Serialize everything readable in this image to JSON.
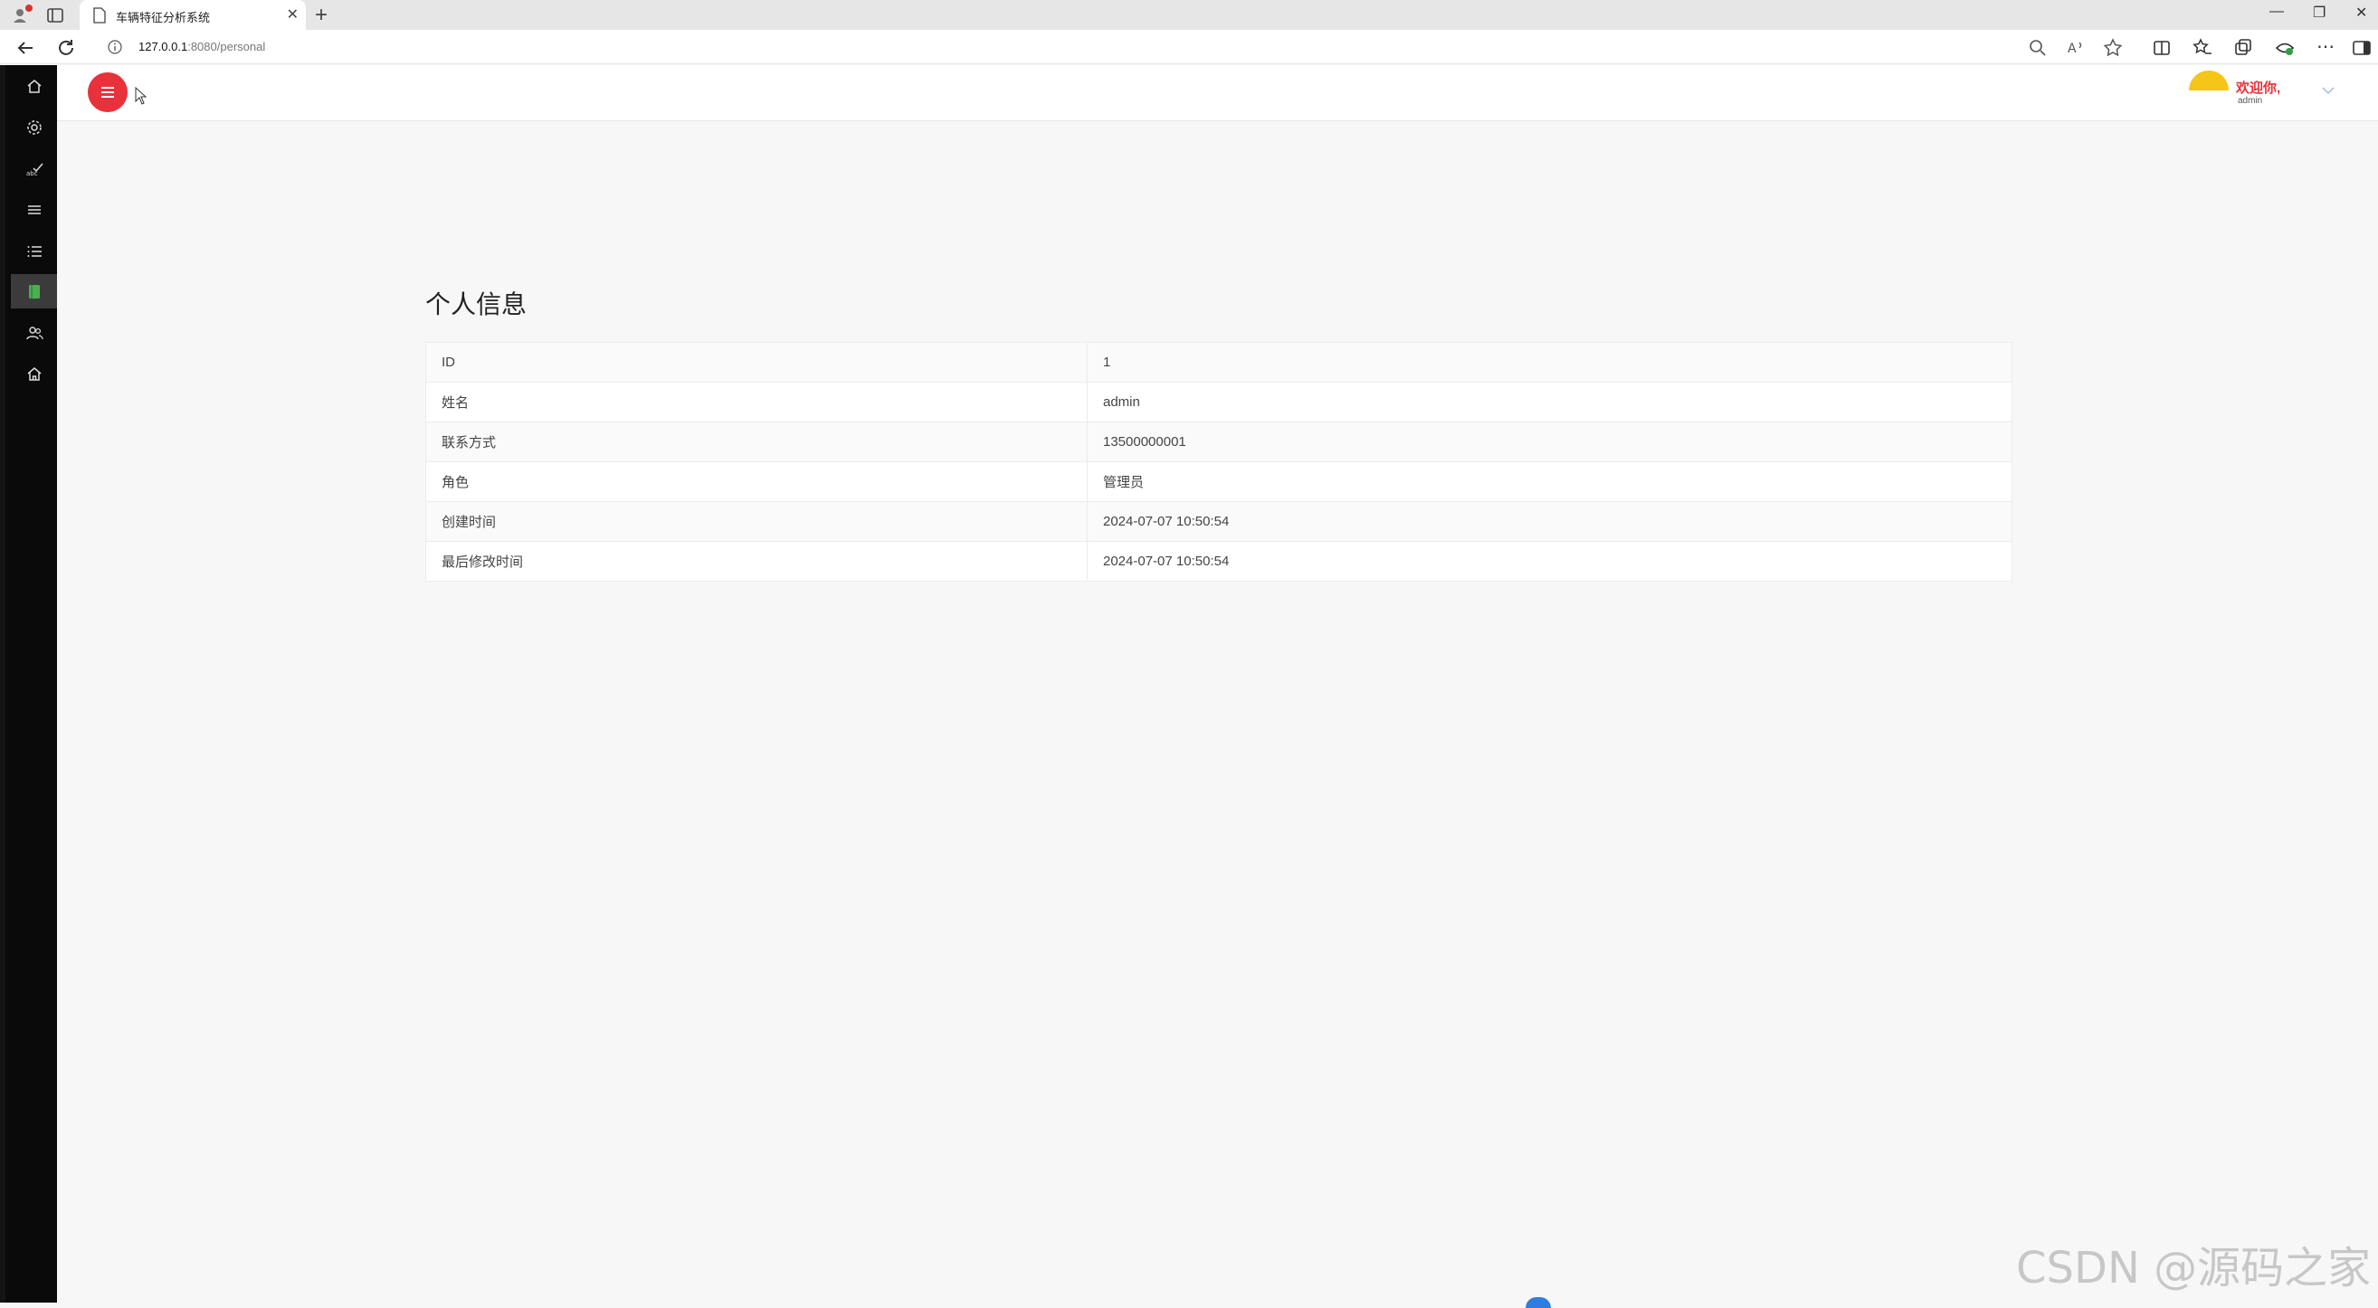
{
  "browser": {
    "tab_title": "车辆特征分析系统",
    "url_host": "127.0.0.1",
    "url_path": ":8080/personal"
  },
  "header": {
    "welcome": "欢迎你,",
    "user": "admin"
  },
  "sidebar": {
    "items": [
      {
        "icon": "home-icon"
      },
      {
        "icon": "gear-icon"
      },
      {
        "icon": "spellcheck-icon"
      },
      {
        "icon": "menu-lines-icon"
      },
      {
        "icon": "list-icon"
      },
      {
        "icon": "book-icon",
        "active": true
      },
      {
        "icon": "users-icon"
      },
      {
        "icon": "home-outline-icon"
      }
    ]
  },
  "main": {
    "title": "个人信息",
    "rows": [
      {
        "label": "ID",
        "value": "1"
      },
      {
        "label": "姓名",
        "value": "admin"
      },
      {
        "label": "联系方式",
        "value": "13500000001"
      },
      {
        "label": "角色",
        "value": "管理员"
      },
      {
        "label": "创建时间",
        "value": "2024-07-07 10:50:54"
      },
      {
        "label": "最后修改时间",
        "value": "2024-07-07 10:50:54"
      }
    ]
  },
  "watermark": "CSDN @源码之家",
  "colors": {
    "accent": "#e8313b",
    "sidebar": "#0a0a0a",
    "avatar": "#f5c518"
  }
}
